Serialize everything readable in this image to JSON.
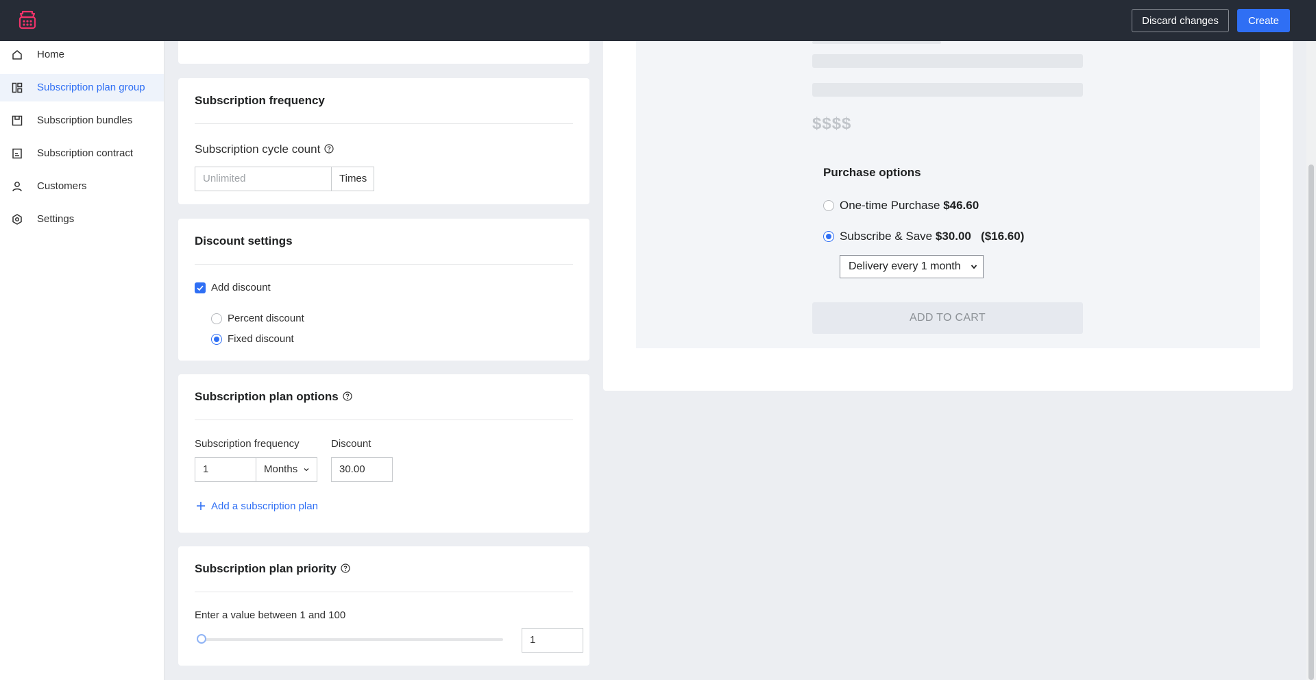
{
  "header": {
    "discard_label": "Discard changes",
    "create_label": "Create",
    "accent": "#2f6ff4",
    "bar_color": "#262c36"
  },
  "sidebar": {
    "items": [
      {
        "label": "Home",
        "icon": "home-icon"
      },
      {
        "label": "Subscription plan group",
        "icon": "layout-icon",
        "active": true
      },
      {
        "label": "Subscription bundles",
        "icon": "bundle-icon"
      },
      {
        "label": "Subscription contract",
        "icon": "contract-icon"
      },
      {
        "label": "Customers",
        "icon": "person-icon"
      },
      {
        "label": "Settings",
        "icon": "gear-icon"
      }
    ]
  },
  "frequency_card": {
    "title": "Subscription frequency",
    "cycle_label": "Subscription cycle count",
    "cycle_placeholder": "Unlimited",
    "cycle_suffix": "Times"
  },
  "discount_card": {
    "title": "Discount settings",
    "add_discount_label": "Add discount",
    "add_discount_checked": true,
    "options": [
      {
        "label": "Percent discount",
        "selected": false
      },
      {
        "label": "Fixed discount",
        "selected": true
      }
    ]
  },
  "plan_options_card": {
    "title": "Subscription plan options",
    "frequency_label": "Subscription frequency",
    "frequency_value": "1",
    "frequency_unit": "Months",
    "discount_label": "Discount",
    "discount_value": "30.00",
    "add_plan_label": "Add a subscription plan"
  },
  "priority_card": {
    "title": "Subscription plan priority",
    "hint": "Enter a value between 1 and 100",
    "value": "1",
    "slider_fraction": 0.01
  },
  "preview": {
    "price_placeholder": "$$$$",
    "purchase_options_title": "Purchase options",
    "one_time_label": "One-time Purchase",
    "one_time_price": "$46.60",
    "subscribe_label": "Subscribe & Save",
    "subscribe_price": "$30.00",
    "subscribe_savings": "($16.60)",
    "selected_option": "subscribe",
    "delivery_value": "Delivery every 1 month",
    "add_to_cart_label": "ADD TO CART"
  }
}
